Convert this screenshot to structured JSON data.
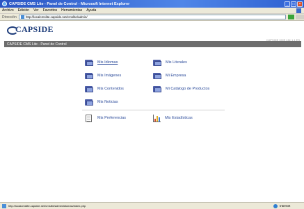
{
  "window": {
    "title": "CAPSIDE CMS Lite - Panel de Control - Microsoft Internet Explorer",
    "buttons": [
      "_",
      "□",
      "×"
    ]
  },
  "menubar": {
    "items": [
      "Archivo",
      "Edición",
      "Ver",
      "Favoritos",
      "Herramientas",
      "Ayuda"
    ]
  },
  "address": {
    "label": "Dirección",
    "url": "http://localcmslite.capside.net/cmslite/admin/"
  },
  "brand": {
    "logo_text": "CAPSIDE",
    "top_link": "CAPSIDE CMS Lite 1.1 ES"
  },
  "panel": {
    "title": "CAPSIDE CMS Lite - Panel de Control"
  },
  "menu": {
    "rows": [
      {
        "left": "Mis Idiomas",
        "right": "Mis Literales"
      },
      {
        "left": "Mis Imágenes",
        "right": "Mi Empresa"
      },
      {
        "left": "Mis Contenidos",
        "right": "Mi Catálogo de Productos"
      },
      {
        "left": "Mis Noticias",
        "right": ""
      }
    ],
    "prefs": "Mis Preferencias",
    "stats": "Mis Estadísticas"
  },
  "colors": {
    "link": "#2a4a9a",
    "panel_bar": "#6d6d6d",
    "logo": "#1d3c7a"
  },
  "status": {
    "url": "http://localcmslite.capside.net/cmslite/admin/idiomas/index.php",
    "zone": "Internet"
  }
}
